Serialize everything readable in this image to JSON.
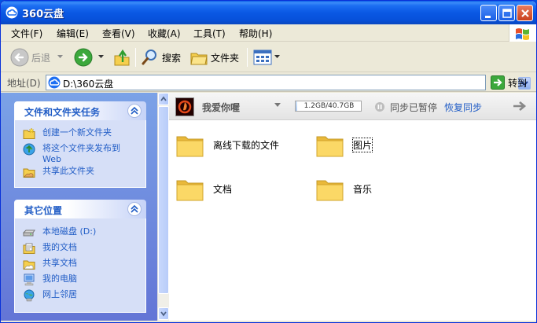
{
  "window": {
    "title": "360云盘"
  },
  "menu": {
    "items": [
      "文件(F)",
      "编辑(E)",
      "查看(V)",
      "收藏(A)",
      "工具(T)",
      "帮助(H)"
    ]
  },
  "toolbar": {
    "back_label": "后退",
    "search_label": "搜索",
    "folders_label": "文件夹"
  },
  "address": {
    "label": "地址(D)",
    "value": "D:\\360云盘",
    "go_label": "转到"
  },
  "tasks": {
    "title": "文件和文件夹任务",
    "items": [
      {
        "label": "创建一个新文件夹",
        "icon": "new-folder-icon"
      },
      {
        "label": "将这个文件夹发布到",
        "sub": "Web",
        "icon": "publish-web-icon"
      },
      {
        "label": "共享此文件夹",
        "icon": "share-folder-icon"
      }
    ]
  },
  "places": {
    "title": "其它位置",
    "items": [
      {
        "label": "本地磁盘 (D:)",
        "icon": "local-disk-icon"
      },
      {
        "label": "我的文档",
        "icon": "my-documents-icon"
      },
      {
        "label": "共享文档",
        "icon": "shared-documents-icon"
      },
      {
        "label": "我的电脑",
        "icon": "my-computer-icon"
      },
      {
        "label": "网上邻居",
        "icon": "network-places-icon"
      }
    ]
  },
  "cloud": {
    "user": "我爱你喔",
    "quota_text": "1.2GB/40.7GB",
    "quota_fraction": 0.029,
    "sync_status": "同步已暂停",
    "sync_resume": "恢复同步"
  },
  "files": [
    {
      "label": "离线下载的文件"
    },
    {
      "label": "图片"
    },
    {
      "label": "文档"
    },
    {
      "label": "音乐"
    }
  ],
  "colors": {
    "titlebar": "#0a58e4",
    "task_link": "#215dc6",
    "pane_bg": "#6375d6",
    "folder": "#f5cf4e"
  }
}
